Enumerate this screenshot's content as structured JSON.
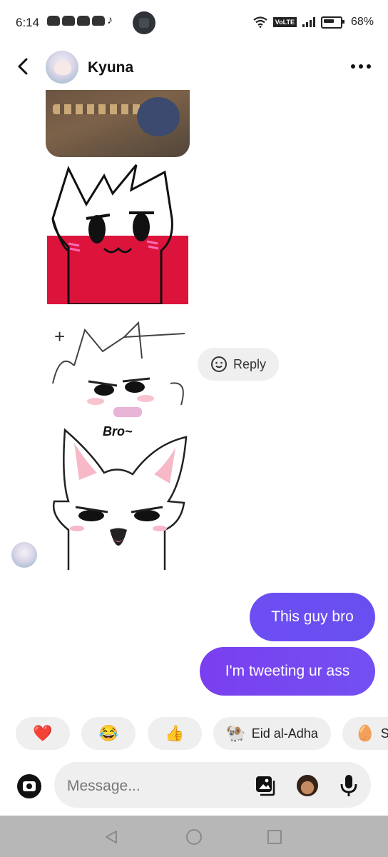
{
  "status_bar": {
    "time": "6:14",
    "network_badge": "VoLTE",
    "battery": "68%"
  },
  "header": {
    "contact_name": "Kyuna"
  },
  "stickers": {
    "caption": "Bro~"
  },
  "reply": {
    "label": "Reply"
  },
  "messages": [
    {
      "text": "This guy bro",
      "sender": "me"
    },
    {
      "text": "I'm tweeting ur ass",
      "sender": "me"
    }
  ],
  "quick_reactions": [
    {
      "emoji": "❤️",
      "label": ""
    },
    {
      "emoji": "😂",
      "label": ""
    },
    {
      "emoji": "👍",
      "label": ""
    },
    {
      "emoji": "🐏",
      "label": "Eid al-Adha"
    },
    {
      "emoji": "🥚",
      "label": "St"
    }
  ],
  "composer": {
    "placeholder": "Message..."
  },
  "colors": {
    "bubble_start": "#6c4ef2",
    "bubble_end": "#7a3fef",
    "chip_bg": "#efefef",
    "navbar_bg": "#b7b7b7"
  }
}
